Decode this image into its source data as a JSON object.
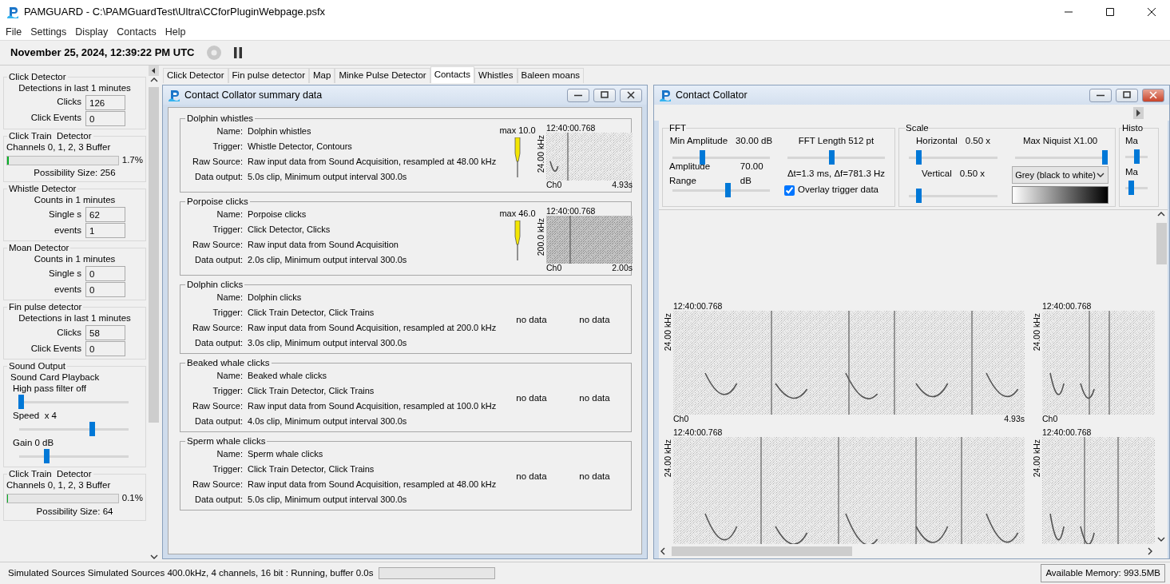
{
  "window": {
    "title": "PAMGUARD - C:\\PAMGuardTest\\Ultra\\CCforPluginWebpage.psfx"
  },
  "menu": [
    "File",
    "Settings",
    "Display",
    "Contacts",
    "Help"
  ],
  "toolbar": {
    "datetime": "November 25, 2024, 12:39:22 PM UTC"
  },
  "sidebar": [
    {
      "kind": "counts",
      "title": "Click Detector",
      "header": "Detections in last 1 minutes",
      "rows": [
        {
          "label": "Clicks",
          "value": "126"
        },
        {
          "label": "Click Events",
          "value": "0"
        }
      ]
    },
    {
      "kind": "buffer",
      "title": "Click Train  Detector",
      "channels": "Channels 0, 1, 2, 3 Buffer",
      "level": 0.017,
      "reading": "1.7%",
      "possibility": "Possibility Size: 256"
    },
    {
      "kind": "counts",
      "title": "Whistle Detector",
      "header": "Counts in 1 minutes",
      "rows": [
        {
          "label": "Single s",
          "value": "62"
        },
        {
          "label": "events",
          "value": "1"
        }
      ]
    },
    {
      "kind": "counts",
      "title": "Moan Detector",
      "header": "Counts in 1 minutes",
      "rows": [
        {
          "label": "Single s",
          "value": "0"
        },
        {
          "label": "events",
          "value": "0"
        }
      ]
    },
    {
      "kind": "counts",
      "title": "Fin pulse detector",
      "header": "Detections in last 1 minutes",
      "rows": [
        {
          "label": "Clicks",
          "value": "58"
        },
        {
          "label": "Click Events",
          "value": "0"
        }
      ]
    },
    {
      "kind": "sound",
      "title": "Sound Output",
      "subtitle": "Sound Card Playback",
      "sliders": [
        {
          "label": "High pass filter off",
          "level": 0
        },
        {
          "label": "Speed  x 4",
          "level": 0.67
        },
        {
          "label": "Gain 0 dB",
          "level": 0.24
        }
      ]
    },
    {
      "kind": "buffer",
      "title": "Click Train  Detector",
      "channels": "Channels 0, 1, 2, 3 Buffer",
      "level": 0.001,
      "reading": "0.1%",
      "possibility": "Possibility Size: 64"
    }
  ],
  "tabs": [
    {
      "label": "Click Detector",
      "selected": false
    },
    {
      "label": "Fin pulse detector",
      "selected": false
    },
    {
      "label": "Map",
      "selected": false
    },
    {
      "label": "Minke Pulse Detector",
      "selected": false
    },
    {
      "label": "Contacts",
      "selected": true
    },
    {
      "label": "Whistles",
      "selected": false
    },
    {
      "label": "Baleen moans",
      "selected": false
    }
  ],
  "summary": {
    "title": "Contact Collator summary data",
    "groups": [
      {
        "title": "Dolphin whistles",
        "fields": [
          {
            "label": "Name:",
            "value": "Dolphin whistles"
          },
          {
            "label": "Trigger:",
            "value": "Whistle Detector, Contours"
          },
          {
            "label": "Raw Source:",
            "value": "Raw input data from Sound Acquisition, resampled at 48.00 kHz"
          },
          {
            "label": "Data output:",
            "value": "5.0s clip, Minimum output interval 300.0s"
          }
        ],
        "clip": {
          "max": "max 10.0",
          "time": "12:40:00.768",
          "axis": "24.00 kHz",
          "channel": "Ch0",
          "duration": "4.93s"
        }
      },
      {
        "title": "Porpoise clicks",
        "fields": [
          {
            "label": "Name:",
            "value": "Porpoise clicks"
          },
          {
            "label": "Trigger:",
            "value": "Click Detector, Clicks"
          },
          {
            "label": "Raw Source:",
            "value": "Raw input data from Sound Acquisition"
          },
          {
            "label": "Data output:",
            "value": "2.0s clip, Minimum output interval 300.0s"
          }
        ],
        "clip": {
          "max": "max 46.0",
          "time": "12:40:00.768",
          "axis": "200.0 kHz",
          "channel": "Ch0",
          "duration": "2.00s"
        }
      },
      {
        "title": "Dolphin clicks",
        "fields": [
          {
            "label": "Name:",
            "value": "Dolphin clicks"
          },
          {
            "label": "Trigger:",
            "value": "Click Train Detector, Click Trains"
          },
          {
            "label": "Raw Source:",
            "value": "Raw input data from Sound Acquisition, resampled at 200.0 kHz"
          },
          {
            "label": "Data output:",
            "value": "3.0s clip, Minimum output interval 300.0s"
          }
        ],
        "no_data": [
          "no data",
          "no data"
        ]
      },
      {
        "title": "Beaked whale clicks",
        "fields": [
          {
            "label": "Name:",
            "value": "Beaked whale clicks"
          },
          {
            "label": "Trigger:",
            "value": "Click Train Detector, Click Trains"
          },
          {
            "label": "Raw Source:",
            "value": "Raw input data from Sound Acquisition, resampled at 100.0 kHz"
          },
          {
            "label": "Data output:",
            "value": "4.0s clip, Minimum output interval 300.0s"
          }
        ],
        "no_data": [
          "no data",
          "no data"
        ]
      },
      {
        "title": "Sperm whale clicks",
        "fields": [
          {
            "label": "Name:",
            "value": "Sperm whale clicks"
          },
          {
            "label": "Trigger:",
            "value": "Click Train Detector, Click Trains"
          },
          {
            "label": "Raw Source:",
            "value": "Raw input data from Sound Acquisition, resampled at 48.00 kHz"
          },
          {
            "label": "Data output:",
            "value": "5.0s clip, Minimum output interval 300.0s"
          }
        ],
        "no_data": [
          "no data",
          "no data"
        ]
      }
    ]
  },
  "collator": {
    "title": "Contact Collator",
    "fft": {
      "title": "FFT",
      "min_amplitude": {
        "label": "Min Amplitude",
        "value": "30.00 dB",
        "level": 0.3
      },
      "amplitude_range": {
        "label": "Amplitude Range",
        "value": "70.00 dB",
        "level": 0.57
      },
      "fft_length": {
        "label": "FFT Length 512 pt",
        "level": 0.45
      },
      "resolution": "Δt=1.3 ms, Δf=781.3 Hz",
      "overlay": {
        "label": "Overlay trigger data",
        "checked": true
      }
    },
    "scale": {
      "title": "Scale",
      "horizontal": {
        "label": "Horizontal",
        "value": "0.50 x",
        "level": 0.1
      },
      "vertical": {
        "label": "Vertical",
        "value": "0.50 x",
        "level": 0.1
      },
      "max_niquist": {
        "label": "Max Niquist X1.00",
        "level": 1
      },
      "colour_map": "Grey (black to white)"
    },
    "history": {
      "title": "Histo",
      "sliders": [
        {
          "label": "Ma",
          "level": 0.5
        },
        {
          "label": "Ma",
          "level": 0.3
        }
      ]
    },
    "clip_rows": [
      [
        {
          "time": "12:40:00.768",
          "axis": "24.00 kHz",
          "channel": "Ch0",
          "duration": "4.93s"
        },
        {
          "time": "12:40:00.768",
          "axis": "24.00 kHz",
          "channel": "Ch0"
        }
      ],
      [
        {
          "time": "12:40:00.768",
          "axis": "24.00 kHz"
        },
        {
          "time": "12:40:00.768",
          "axis": "24.00 kHz"
        }
      ]
    ]
  },
  "status_bar": {
    "text": "Simulated Sources Simulated Sources 400.0kHz, 4 channels, 16 bit : Running, buffer 0.0s",
    "level": 0,
    "memory": "Available Memory: 993.5MB"
  }
}
